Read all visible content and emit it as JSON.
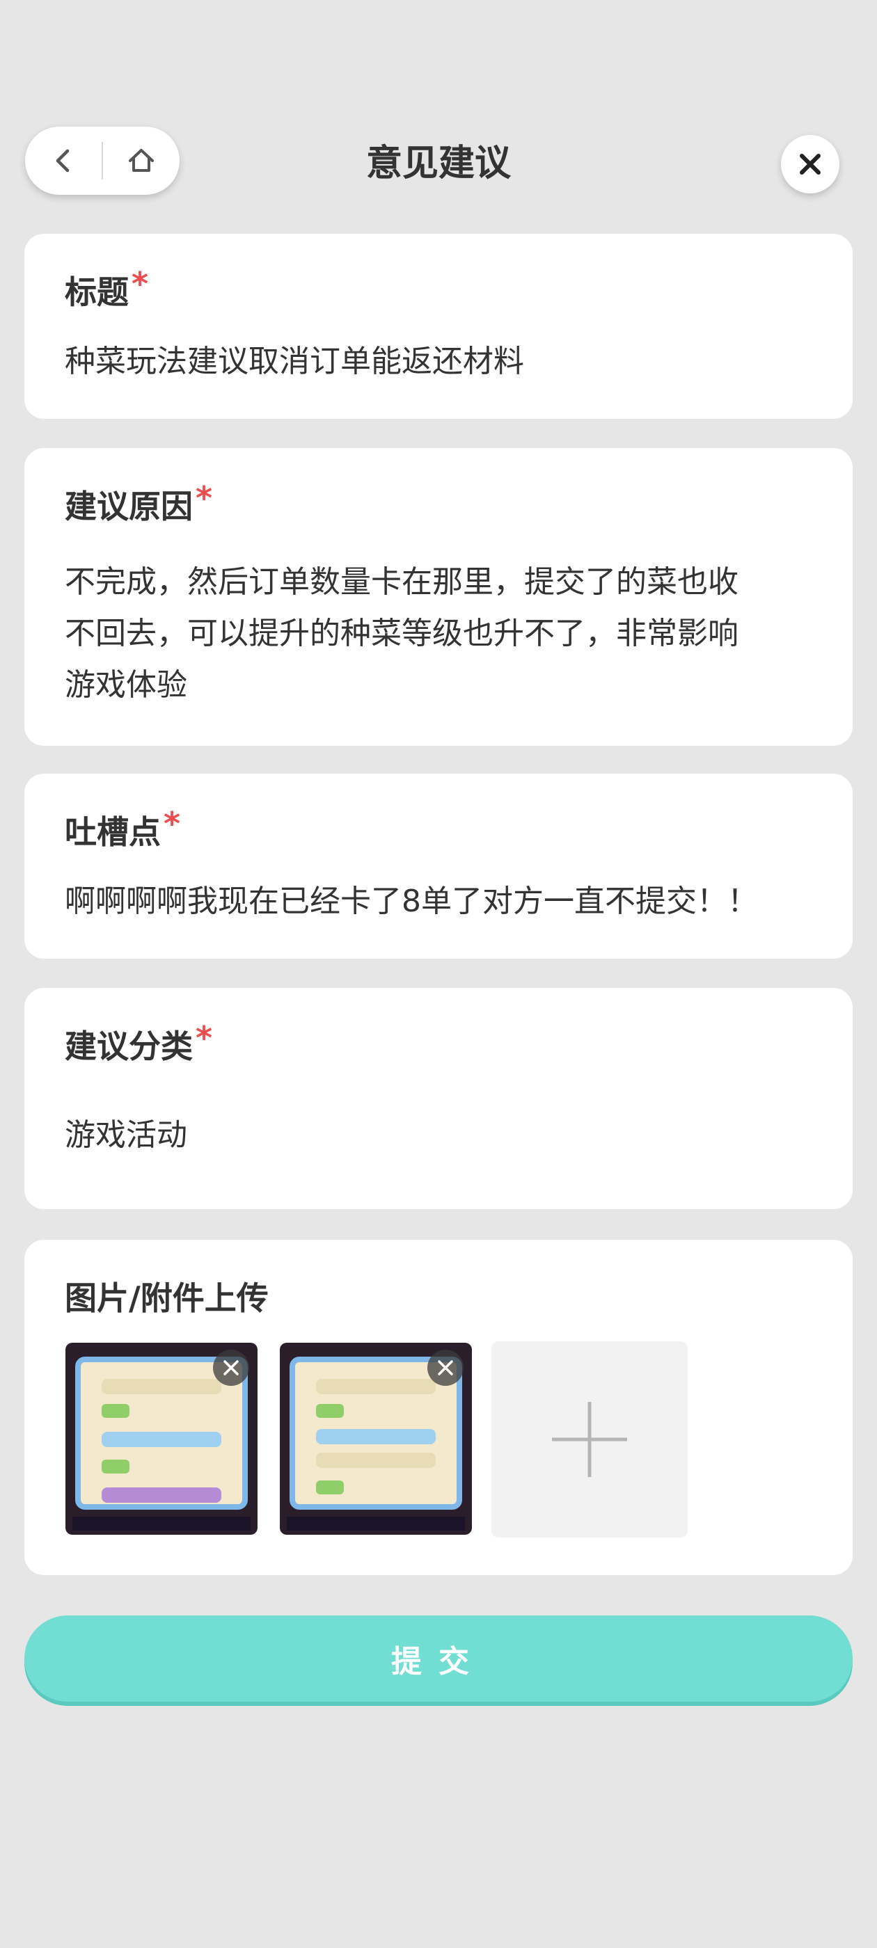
{
  "header": {
    "title": "意见建议",
    "back_icon": "chevron-left-icon",
    "home_icon": "home-icon",
    "close_icon": "close-icon"
  },
  "form": {
    "required_mark": "*",
    "title_field": {
      "label": "标题",
      "value": "种菜玩法建议取消订单能返还材料"
    },
    "reason_field": {
      "label": "建议原因",
      "value_lines": [
        "不完成，然后订单数量卡在那里，提交了的菜也收",
        "不回去，可以提升的种菜等级也升不了，非常影响",
        "游戏体验"
      ]
    },
    "complaint_field": {
      "label": "吐槽点",
      "value": "啊啊啊啊我现在已经卡了8单了对方一直不提交！！"
    },
    "category_field": {
      "label": "建议分类",
      "value": "游戏活动"
    },
    "upload": {
      "label": "图片/附件上传",
      "remove_icon": "close-icon",
      "add_icon": "plus-icon"
    }
  },
  "submit": {
    "label": "提交"
  },
  "colors": {
    "background": "#e6e6e6",
    "card": "#ffffff",
    "required": "#ef4d4d",
    "submit": "#72ddd3"
  }
}
